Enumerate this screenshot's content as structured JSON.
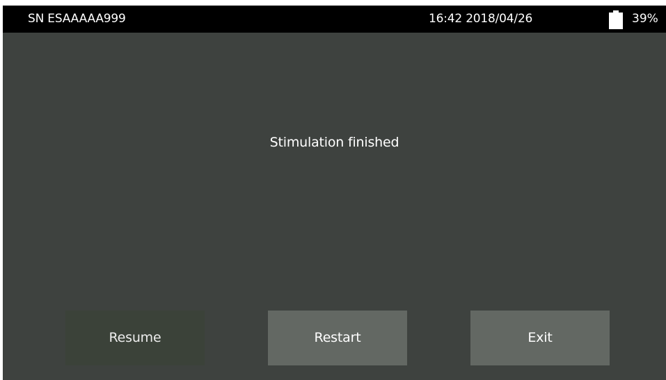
{
  "status_bar": {
    "serial": "SN ESAAAAA999",
    "datetime": "16:42 2018/04/26",
    "battery_icon": "battery-icon",
    "battery_percent": "39%"
  },
  "main": {
    "message": "Stimulation finished"
  },
  "buttons": {
    "resume_label": "Resume",
    "restart_label": "Restart",
    "exit_label": "Exit"
  },
  "colors": {
    "screen_background": "#3e423f",
    "status_bar_background": "#000000",
    "button_active": "#636863",
    "button_resume": "#3b4239",
    "text": "#ffffff"
  }
}
